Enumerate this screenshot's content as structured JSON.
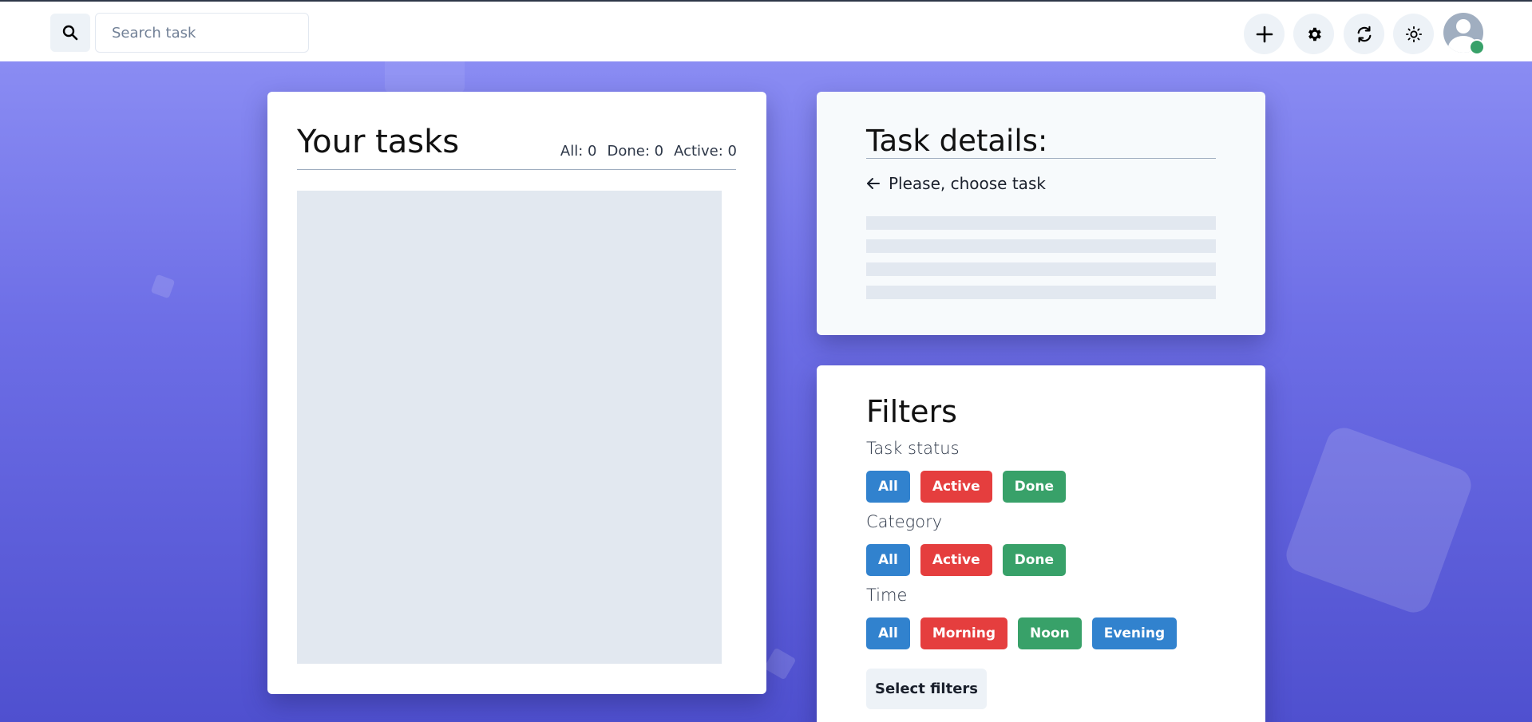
{
  "header": {
    "search_placeholder": "Search task",
    "icons": [
      "search-icon",
      "plus-icon",
      "gear-icon",
      "refresh-icon",
      "sun-icon",
      "user-avatar-icon"
    ]
  },
  "tasks": {
    "title": "Your tasks",
    "counts": {
      "all": "All: 0",
      "done": "Done: 0",
      "active": "Active: 0"
    }
  },
  "details": {
    "title": "Task details:",
    "hint": "Please, choose task"
  },
  "filters": {
    "title": "Filters",
    "task_status": {
      "label": "Task status",
      "buttons": [
        "All",
        "Active",
        "Done"
      ]
    },
    "category": {
      "label": "Category",
      "buttons": [
        "All",
        "Active",
        "Done"
      ]
    },
    "time": {
      "label": "Time",
      "buttons": [
        "All",
        "Morning",
        "Noon",
        "Evening"
      ]
    },
    "select_label": "Select filters"
  },
  "colors": {
    "blue": "#3182ce",
    "red": "#e53e3e",
    "green": "#38a169",
    "status_online": "#38a169"
  }
}
